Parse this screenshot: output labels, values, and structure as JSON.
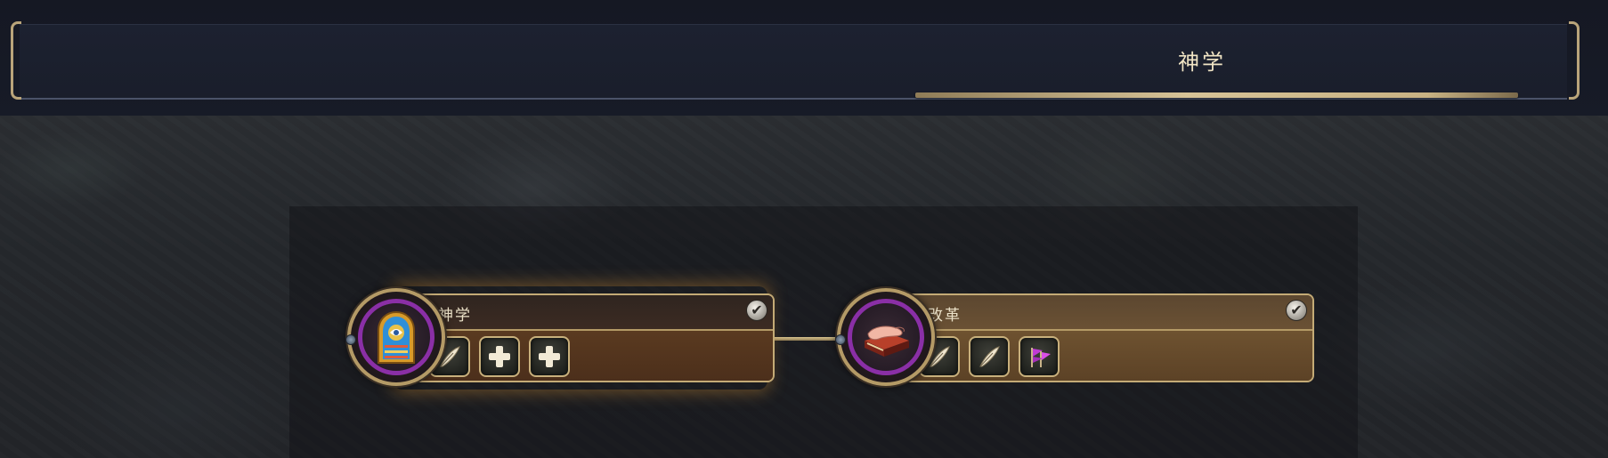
{
  "header": {
    "title": "神学"
  },
  "tree": {
    "nodes": [
      {
        "id": "theology",
        "name": "神学",
        "completed": true,
        "icon": "stained-glass-window-icon",
        "slots": [
          "quill-icon",
          "plus-icon",
          "plus-icon"
        ]
      },
      {
        "id": "reformation",
        "name": "改革",
        "completed": true,
        "icon": "hand-on-book-icon",
        "slots": [
          "quill-icon",
          "quill-icon",
          "purple-flag-icon"
        ]
      }
    ]
  },
  "colors": {
    "gold_trim": "#c4ab76",
    "medallion_ring": "#8a2fa6",
    "header_text": "#f0e4c4"
  }
}
